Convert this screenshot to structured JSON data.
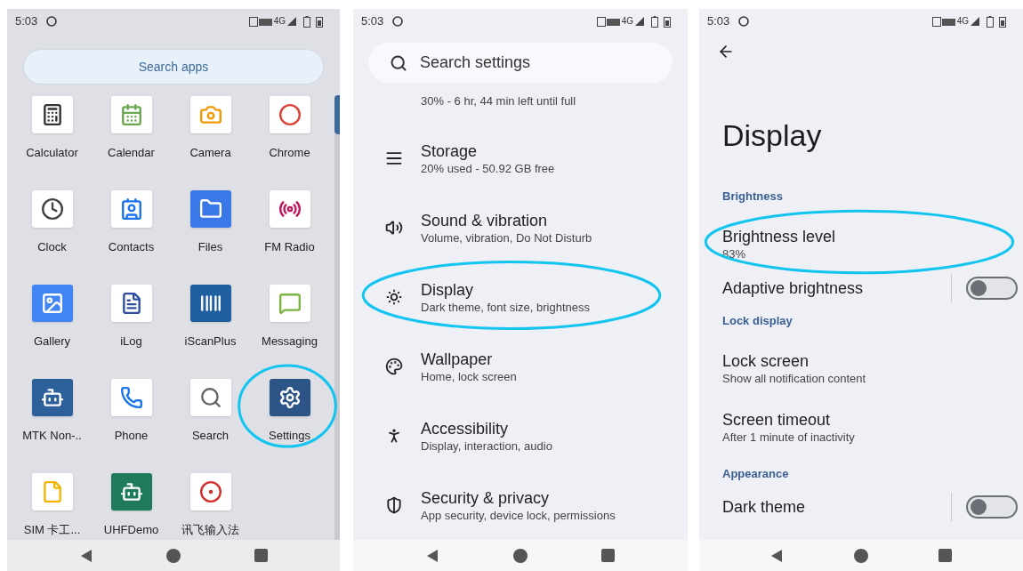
{
  "launcher": {
    "status_bar": {
      "time": "5:03",
      "network": "4G"
    },
    "search": {
      "placeholder": "Search apps"
    },
    "apps": [
      {
        "label": "Calculator",
        "highlighted": false
      },
      {
        "label": "Calendar",
        "highlighted": false
      },
      {
        "label": "Camera",
        "highlighted": false
      },
      {
        "label": "Chrome",
        "highlighted": false
      },
      {
        "label": "Clock",
        "highlighted": false
      },
      {
        "label": "Contacts",
        "highlighted": false
      },
      {
        "label": "Files",
        "highlighted": false
      },
      {
        "label": "FM Radio",
        "highlighted": false
      },
      {
        "label": "Gallery",
        "highlighted": false
      },
      {
        "label": "iLog",
        "highlighted": false
      },
      {
        "label": "iScanPlus",
        "highlighted": false
      },
      {
        "label": "Messaging",
        "highlighted": false
      },
      {
        "label": "MTK Non-..",
        "highlighted": false
      },
      {
        "label": "Phone",
        "highlighted": false
      },
      {
        "label": "Search",
        "highlighted": false
      },
      {
        "label": "Settings",
        "highlighted": true
      },
      {
        "label": "SIM 卡工...",
        "highlighted": false
      },
      {
        "label": "UHFDemo",
        "highlighted": false
      },
      {
        "label": "讯飞输入法",
        "highlighted": false
      }
    ]
  },
  "settings": {
    "status_bar": {
      "time": "5:03",
      "network": "4G"
    },
    "search": {
      "placeholder": "Search settings"
    },
    "battery_summary": "30% - 6 hr, 44 min left until full",
    "rows": [
      {
        "title": "Storage",
        "subtitle": "20% used - 50.92 GB free",
        "highlighted": false
      },
      {
        "title": "Sound & vibration",
        "subtitle": "Volume, vibration, Do Not Disturb",
        "highlighted": false
      },
      {
        "title": "Display",
        "subtitle": "Dark theme, font size, brightness",
        "highlighted": true
      },
      {
        "title": "Wallpaper",
        "subtitle": "Home, lock screen",
        "highlighted": false
      },
      {
        "title": "Accessibility",
        "subtitle": "Display, interaction, audio",
        "highlighted": false
      },
      {
        "title": "Security & privacy",
        "subtitle": "App security, device lock, permissions",
        "highlighted": false
      }
    ]
  },
  "display": {
    "status_bar": {
      "time": "5:03",
      "network": "4G"
    },
    "title": "Display",
    "rows": [
      {
        "kind": "header",
        "title": "Brightness"
      },
      {
        "kind": "item",
        "title": "Brightness level",
        "subtitle": "83%",
        "highlighted": true
      },
      {
        "kind": "switch",
        "title": "Adaptive brightness",
        "on": false
      },
      {
        "kind": "header",
        "title": "Lock display"
      },
      {
        "kind": "item",
        "title": "Lock screen",
        "subtitle": "Show all notification content",
        "highlighted": false
      },
      {
        "kind": "item",
        "title": "Screen timeout",
        "subtitle": "After 1 minute of inactivity",
        "highlighted": false
      },
      {
        "kind": "header",
        "title": "Appearance"
      },
      {
        "kind": "switch",
        "title": "Dark theme",
        "on": false
      }
    ]
  }
}
